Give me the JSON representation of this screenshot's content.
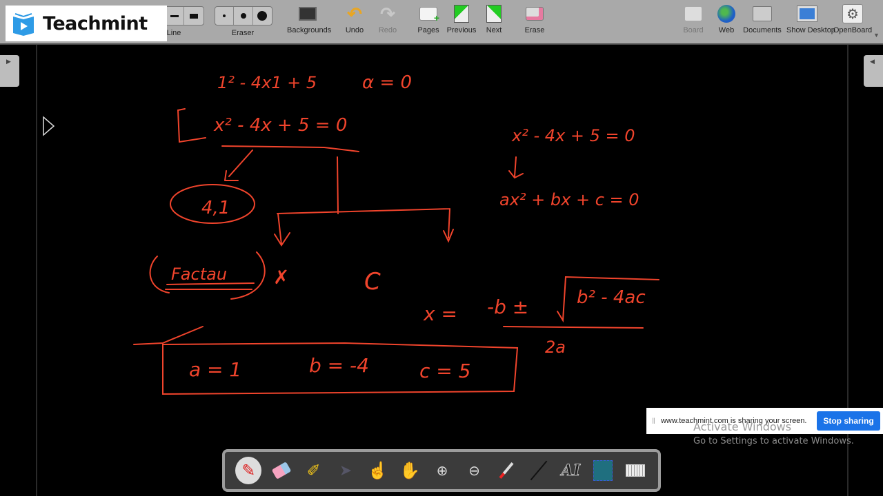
{
  "logo": {
    "text": "Teachmint"
  },
  "toolbar": {
    "line_label": "Line",
    "eraser_label": "Eraser",
    "backgrounds_label": "Backgrounds",
    "undo_label": "Undo",
    "redo_label": "Redo",
    "pages_label": "Pages",
    "previous_label": "Previous",
    "next_label": "Next",
    "erase_label": "Erase",
    "board_label": "Board",
    "web_label": "Web",
    "documents_label": "Documents",
    "show_desktop_label": "Show Desktop",
    "openboard_label": "OpenBoard"
  },
  "board": {
    "ink_color": "#f0442c",
    "line1": "1² - 4x1 + 5",
    "line1b": "α = 0",
    "eq_left": "x² - 4x + 5 = 0",
    "roots": "4,1",
    "factor": "Factau",
    "cross": "✗",
    "c_label": "C",
    "eq_right": "x² - 4x + 5 = 0",
    "general": "ax² + bx + c = 0",
    "formula_lhs": "x =",
    "formula_num_a": "-b ±",
    "formula_num_b": "b² - 4ac",
    "formula_den": "2a",
    "coef_a": "a = 1",
    "coef_b": "b = -4",
    "coef_c": "c = 5"
  },
  "share_bar": {
    "message": "www.teachmint.com is sharing your screen.",
    "stop_label": "Stop sharing"
  },
  "watermark": {
    "title": "Activate Windows",
    "subtitle": "Go to Settings to activate Windows."
  },
  "dock": {
    "tools": [
      "pen",
      "eraser",
      "marker",
      "selector",
      "interact",
      "hand",
      "zoom-in",
      "zoom-out",
      "laser-pointer",
      "line",
      "text",
      "capture",
      "virtual-keyboard"
    ],
    "selected": "pen"
  }
}
